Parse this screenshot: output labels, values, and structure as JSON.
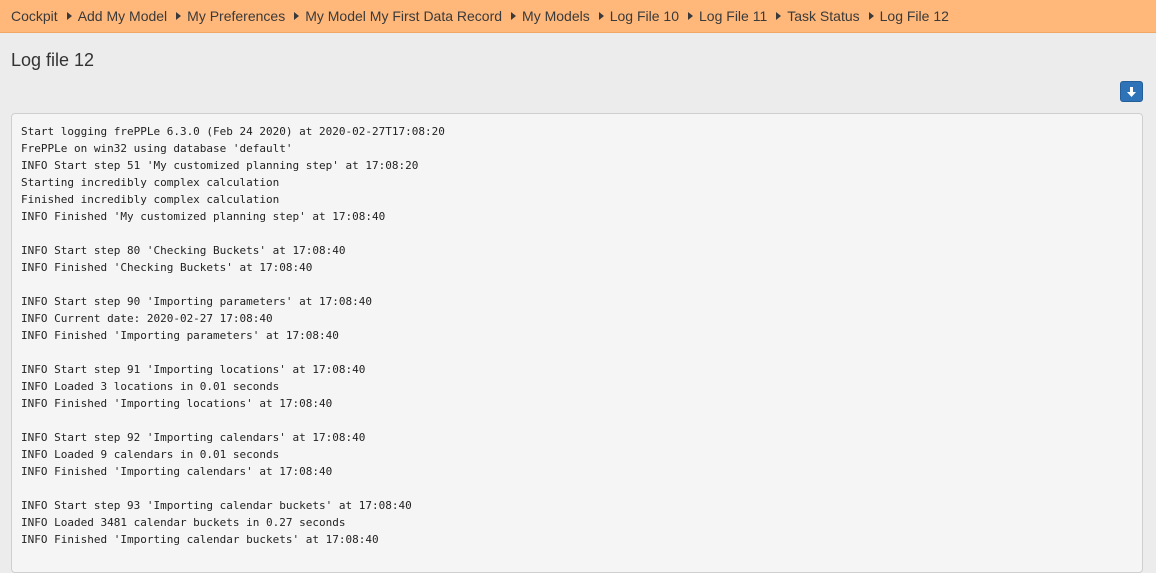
{
  "breadcrumb": [
    {
      "label": "Cockpit"
    },
    {
      "label": "Add My Model"
    },
    {
      "label": "My Preferences"
    },
    {
      "label": "My Model My First Data Record"
    },
    {
      "label": "My Models"
    },
    {
      "label": "Log File 10"
    },
    {
      "label": "Log File 11"
    },
    {
      "label": "Task Status"
    },
    {
      "label": "Log File 12"
    }
  ],
  "page": {
    "title": "Log file 12",
    "download_icon": "arrow-down-icon"
  },
  "colors": {
    "breadcrumb_bg": "#ffb87a",
    "button_bg": "#2e73b8"
  },
  "log": {
    "lines": [
      "Start logging frePPLe 6.3.0 (Feb 24 2020) at 2020-02-27T17:08:20",
      "FrePPLe on win32 using database 'default'",
      "INFO Start step 51 'My customized planning step' at 17:08:20",
      "Starting incredibly complex calculation",
      "Finished incredibly complex calculation",
      "INFO Finished 'My customized planning step' at 17:08:40",
      "",
      "INFO Start step 80 'Checking Buckets' at 17:08:40",
      "INFO Finished 'Checking Buckets' at 17:08:40",
      "",
      "INFO Start step 90 'Importing parameters' at 17:08:40",
      "INFO Current date: 2020-02-27 17:08:40",
      "INFO Finished 'Importing parameters' at 17:08:40",
      "",
      "INFO Start step 91 'Importing locations' at 17:08:40",
      "INFO Loaded 3 locations in 0.01 seconds",
      "INFO Finished 'Importing locations' at 17:08:40",
      "",
      "INFO Start step 92 'Importing calendars' at 17:08:40",
      "INFO Loaded 9 calendars in 0.01 seconds",
      "INFO Finished 'Importing calendars' at 17:08:40",
      "",
      "INFO Start step 93 'Importing calendar buckets' at 17:08:40",
      "INFO Loaded 3481 calendar buckets in 0.27 seconds",
      "INFO Finished 'Importing calendar buckets' at 17:08:40"
    ]
  }
}
